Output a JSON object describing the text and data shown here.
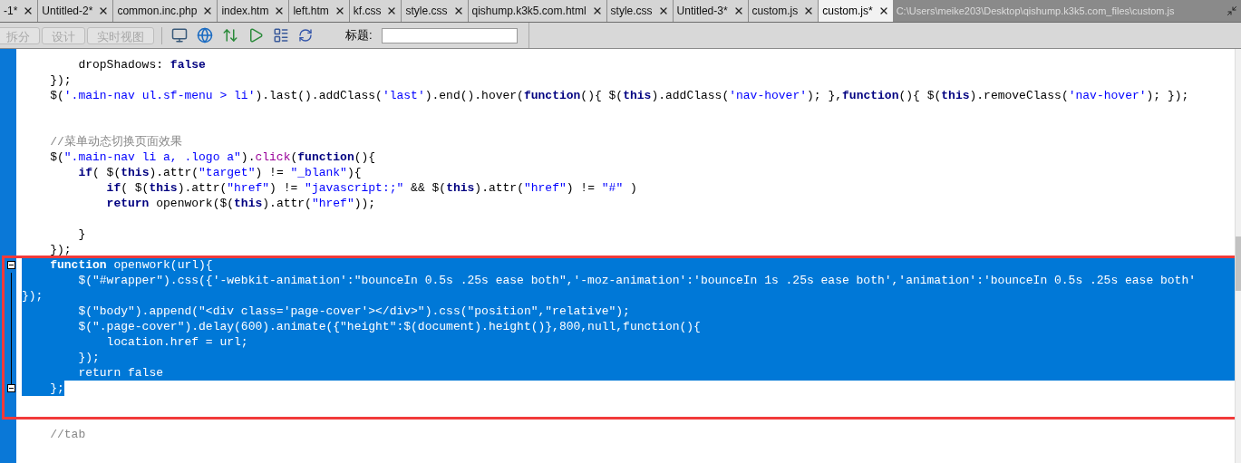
{
  "tabs": [
    {
      "label": "-1*",
      "selected": false
    },
    {
      "label": "Untitled-2*",
      "selected": false
    },
    {
      "label": "common.inc.php",
      "selected": false
    },
    {
      "label": "index.htm",
      "selected": false
    },
    {
      "label": "left.htm",
      "selected": false
    },
    {
      "label": "kf.css",
      "selected": false
    },
    {
      "label": "style.css",
      "selected": false
    },
    {
      "label": "qishump.k3k5.com.html",
      "selected": false
    },
    {
      "label": "style.css",
      "selected": false
    },
    {
      "label": "Untitled-3*",
      "selected": false
    },
    {
      "label": "custom.js",
      "selected": false
    },
    {
      "label": "custom.js*",
      "selected": true
    }
  ],
  "file_path": "C:\\Users\\meike203\\Desktop\\qishump.k3k5.com_files\\custom.js",
  "toolbar": {
    "view_buttons": [
      {
        "label": "拆分",
        "disabled": true
      },
      {
        "label": "设计",
        "disabled": true
      },
      {
        "label": "实时视图",
        "disabled": true
      }
    ],
    "title_label": "标题:"
  },
  "code_lines": [
    {
      "selected": false,
      "fold": false,
      "segments": [
        {
          "kind": "plain",
          "text": "        dropShadows: "
        },
        {
          "kind": "keyword",
          "text": "false"
        }
      ]
    },
    {
      "selected": false,
      "fold": false,
      "segments": [
        {
          "kind": "plain",
          "text": "    });"
        }
      ]
    },
    {
      "selected": false,
      "fold": false,
      "segments": [
        {
          "kind": "plain",
          "text": "    $("
        },
        {
          "kind": "string",
          "text": "'.main-nav ul.sf-menu > li'"
        },
        {
          "kind": "plain",
          "text": ").last().addClass("
        },
        {
          "kind": "string",
          "text": "'last'"
        },
        {
          "kind": "plain",
          "text": ").end().hover("
        },
        {
          "kind": "keyword",
          "text": "function"
        },
        {
          "kind": "plain",
          "text": "(){ $("
        },
        {
          "kind": "keyword",
          "text": "this"
        },
        {
          "kind": "plain",
          "text": ").addClass("
        },
        {
          "kind": "string",
          "text": "'nav-hover'"
        },
        {
          "kind": "plain",
          "text": "); },"
        },
        {
          "kind": "keyword",
          "text": "function"
        },
        {
          "kind": "plain",
          "text": "(){ $("
        },
        {
          "kind": "keyword",
          "text": "this"
        },
        {
          "kind": "plain",
          "text": ").removeClass("
        },
        {
          "kind": "string",
          "text": "'nav-hover'"
        },
        {
          "kind": "plain",
          "text": "); });"
        }
      ]
    },
    {
      "selected": false,
      "fold": false
    },
    {
      "selected": false,
      "fold": false
    },
    {
      "selected": false,
      "fold": false,
      "segments": [
        {
          "kind": "comment",
          "text": "    //菜单动态切换页面效果"
        }
      ]
    },
    {
      "selected": false,
      "fold": false,
      "segments": [
        {
          "kind": "plain",
          "text": "    $("
        },
        {
          "kind": "string",
          "text": "\".main-nav li a, .logo a\""
        },
        {
          "kind": "plain",
          "text": ")."
        },
        {
          "kind": "method",
          "text": "click"
        },
        {
          "kind": "plain",
          "text": "("
        },
        {
          "kind": "keyword",
          "text": "function"
        },
        {
          "kind": "plain",
          "text": "(){"
        }
      ]
    },
    {
      "selected": false,
      "fold": false,
      "segments": [
        {
          "kind": "keyword",
          "text": "        if"
        },
        {
          "kind": "plain",
          "text": "( $("
        },
        {
          "kind": "keyword",
          "text": "this"
        },
        {
          "kind": "plain",
          "text": ").attr("
        },
        {
          "kind": "string",
          "text": "\"target\""
        },
        {
          "kind": "plain",
          "text": ") != "
        },
        {
          "kind": "string",
          "text": "\"_blank\""
        },
        {
          "kind": "plain",
          "text": "){"
        }
      ]
    },
    {
      "selected": false,
      "fold": false,
      "segments": [
        {
          "kind": "keyword",
          "text": "            if"
        },
        {
          "kind": "plain",
          "text": "( $("
        },
        {
          "kind": "keyword",
          "text": "this"
        },
        {
          "kind": "plain",
          "text": ").attr("
        },
        {
          "kind": "string",
          "text": "\"href\""
        },
        {
          "kind": "plain",
          "text": ") != "
        },
        {
          "kind": "string",
          "text": "\"javascript:;\""
        },
        {
          "kind": "plain",
          "text": " && $("
        },
        {
          "kind": "keyword",
          "text": "this"
        },
        {
          "kind": "plain",
          "text": ").attr("
        },
        {
          "kind": "string",
          "text": "\"href\""
        },
        {
          "kind": "plain",
          "text": ") != "
        },
        {
          "kind": "string",
          "text": "\"#\""
        },
        {
          "kind": "plain",
          "text": " )"
        }
      ]
    },
    {
      "selected": false,
      "fold": false,
      "segments": [
        {
          "kind": "keyword",
          "text": "            return"
        },
        {
          "kind": "plain",
          "text": " openwork($("
        },
        {
          "kind": "keyword",
          "text": "this"
        },
        {
          "kind": "plain",
          "text": ").attr("
        },
        {
          "kind": "string",
          "text": "\"href\""
        },
        {
          "kind": "plain",
          "text": "));"
        }
      ]
    },
    {
      "selected": false,
      "fold": false
    },
    {
      "selected": false,
      "fold": false,
      "segments": [
        {
          "kind": "plain",
          "text": "        }"
        }
      ]
    },
    {
      "selected": false,
      "fold": false,
      "segments": [
        {
          "kind": "plain",
          "text": "    });"
        }
      ]
    },
    {
      "selected": true,
      "fold": true,
      "segments": [
        {
          "kind": "keyword",
          "text": "    function"
        },
        {
          "kind": "plain",
          "text": " openwork(url){"
        }
      ]
    },
    {
      "selected": true,
      "fold": false,
      "segments": [
        {
          "kind": "plain",
          "text": "        $(\"#wrapper\").css({'-webkit-animation':\"bounceIn 0.5s .25s ease both\",'-moz-animation':'bounceIn 1s .25s ease both','animation':'bounceIn 0.5s .25s ease both'"
        }
      ]
    },
    {
      "selected": true,
      "fold": false,
      "segments": [
        {
          "kind": "plain",
          "text": "});"
        }
      ]
    },
    {
      "selected": true,
      "fold": false,
      "segments": [
        {
          "kind": "plain",
          "text": "        $(\"body\").append(\"<div class='page-cover'></div>\").css(\"position\",\"relative\");"
        }
      ]
    },
    {
      "selected": true,
      "fold": false,
      "segments": [
        {
          "kind": "plain",
          "text": "        $(\".page-cover\").delay(600).animate({\"height\":$(document).height()},800,null,function(){"
        }
      ]
    },
    {
      "selected": true,
      "fold": false,
      "segments": [
        {
          "kind": "plain",
          "text": "            location.href = url;"
        }
      ]
    },
    {
      "selected": true,
      "fold": false,
      "segments": [
        {
          "kind": "plain",
          "text": "        });"
        }
      ]
    },
    {
      "selected": true,
      "fold": false,
      "segments": [
        {
          "kind": "plain",
          "text": "        return false"
        }
      ]
    },
    {
      "selected": true,
      "fold": true,
      "segments": [
        {
          "kind": "plain",
          "text": "    };"
        }
      ]
    },
    {
      "selected": false,
      "fold": false
    },
    {
      "selected": false,
      "fold": false
    },
    {
      "selected": false,
      "fold": false,
      "segments": [
        {
          "kind": "comment",
          "text": "    //tab"
        }
      ]
    }
  ]
}
